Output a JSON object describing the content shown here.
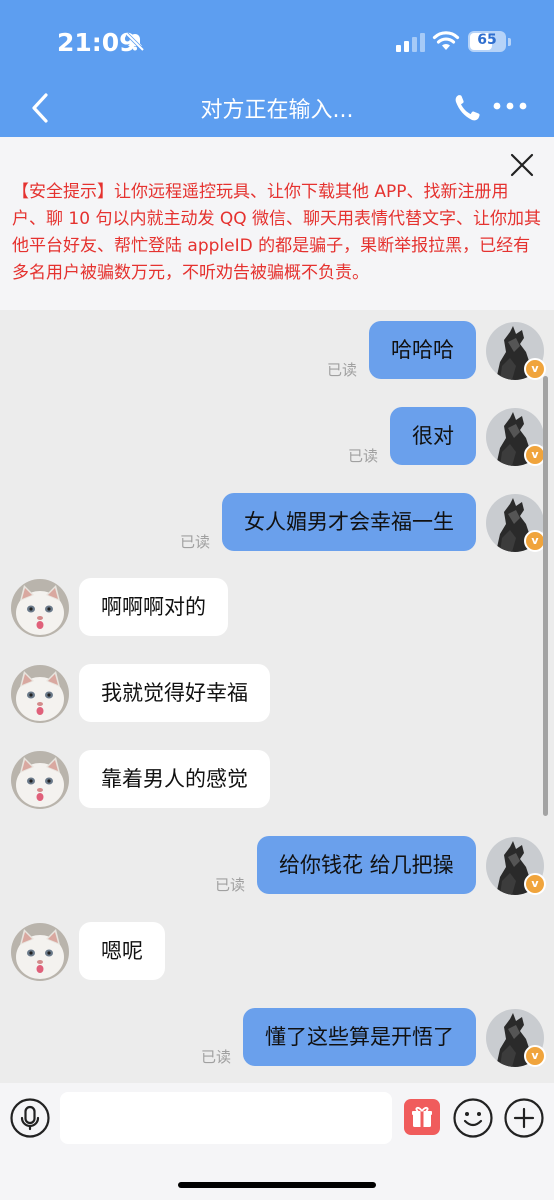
{
  "status_bar": {
    "time": "21:09",
    "battery": "65",
    "battery_level": 0.65
  },
  "header": {
    "title": "对方正在输入..."
  },
  "warning": {
    "text": "【安全提示】让你远程遥控玩具、让你下载其他 APP、找新注册用户、聊 10 句以内就主动发 QQ 微信、聊天用表情代替文字、让你加其他平台好友、帮忙登陆 appleID 的都是骗子，果断举报拉黑，已经有多名用户被骗数万元，不听劝告被骗概不负责。"
  },
  "messages": [
    {
      "dir": "out",
      "text": "哈哈哈",
      "status": "已读"
    },
    {
      "dir": "out",
      "text": "很对",
      "status": "已读"
    },
    {
      "dir": "out",
      "text": "女人媚男才会幸福一生",
      "status": "已读"
    },
    {
      "dir": "in",
      "text": "啊啊啊对的"
    },
    {
      "dir": "in",
      "text": "我就觉得好幸福"
    },
    {
      "dir": "in",
      "text": "靠着男人的感觉"
    },
    {
      "dir": "out",
      "text": "给你钱花 给几把操",
      "status": "已读"
    },
    {
      "dir": "in",
      "text": "嗯呢"
    },
    {
      "dir": "out",
      "text": "懂了这些算是开悟了",
      "status": "已读"
    }
  ],
  "icons": {
    "back": "chevron-left-icon",
    "call": "phone-icon",
    "more": "more-dots-icon",
    "close": "close-icon",
    "voice": "microphone-icon",
    "gift": "gift-icon",
    "emoji": "smiley-icon",
    "add": "plus-icon"
  },
  "colors": {
    "header_bg": "#5d9ef0",
    "outgoing_bubble": "#6aa0ec",
    "incoming_bubble": "#ffffff",
    "warning_text": "#e5322f",
    "chat_bg": "#ececec"
  }
}
